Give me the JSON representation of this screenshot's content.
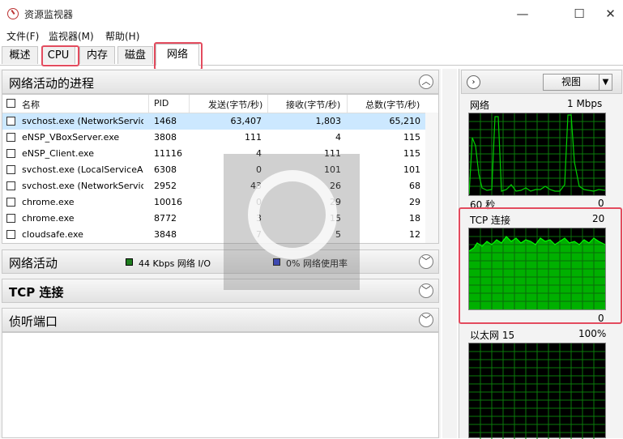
{
  "window": {
    "title": "资源监视器",
    "minimize": "—",
    "maximize": "☐",
    "close": "✕"
  },
  "menu": [
    "文件(F)",
    "监视器(M)",
    "帮助(H)"
  ],
  "tabs": [
    "概述",
    "CPU",
    "内存",
    "磁盘",
    "网络"
  ],
  "active_tab": "网络",
  "processes_section": {
    "title": "网络活动的进程",
    "columns": [
      "名称",
      "PID",
      "发送(字节/秒)",
      "接收(字节/秒)",
      "总数(字节/秒)"
    ],
    "rows": [
      [
        "svchost.exe (NetworkService)",
        "1468",
        "63,407",
        "1,803",
        "65,210"
      ],
      [
        "eNSP_VBoxServer.exe",
        "3808",
        "111",
        "4",
        "115"
      ],
      [
        "eNSP_Client.exe",
        "11116",
        "4",
        "111",
        "115"
      ],
      [
        "svchost.exe (LocalServiceA...",
        "6308",
        "0",
        "101",
        "101"
      ],
      [
        "svchost.exe (NetworkServic...",
        "2952",
        "43",
        "26",
        "68"
      ],
      [
        "chrome.exe",
        "10016",
        "0",
        "29",
        "29"
      ],
      [
        "chrome.exe",
        "8772",
        "3",
        "15",
        "18"
      ],
      [
        "cloudsafe.exe",
        "3848",
        "7",
        "5",
        "12"
      ]
    ]
  },
  "network_activity": {
    "title": "网络活动",
    "io_label": "44 Kbps 网络 I/O",
    "usage_label": "0% 网络使用率",
    "io_color": "#1e7d1e",
    "usage_color": "#2030d0"
  },
  "tcp_section": {
    "title": "TCP 连接"
  },
  "listen_section": {
    "title": "侦听端口"
  },
  "right_panel": {
    "view_label": "视图",
    "graphs": [
      {
        "name": "网络",
        "max": "1 Mbps",
        "footer_left": "60 秒",
        "footer_right": "0"
      },
      {
        "name": "TCP 连接",
        "max": "20",
        "footer_right": "0"
      },
      {
        "name": "以太网 15",
        "max": "100%",
        "footer_right": ""
      }
    ]
  },
  "colors": {
    "highlight": "#e34b5e",
    "graph_green": "#00c000",
    "graph_grid": "#0a7a0a"
  }
}
